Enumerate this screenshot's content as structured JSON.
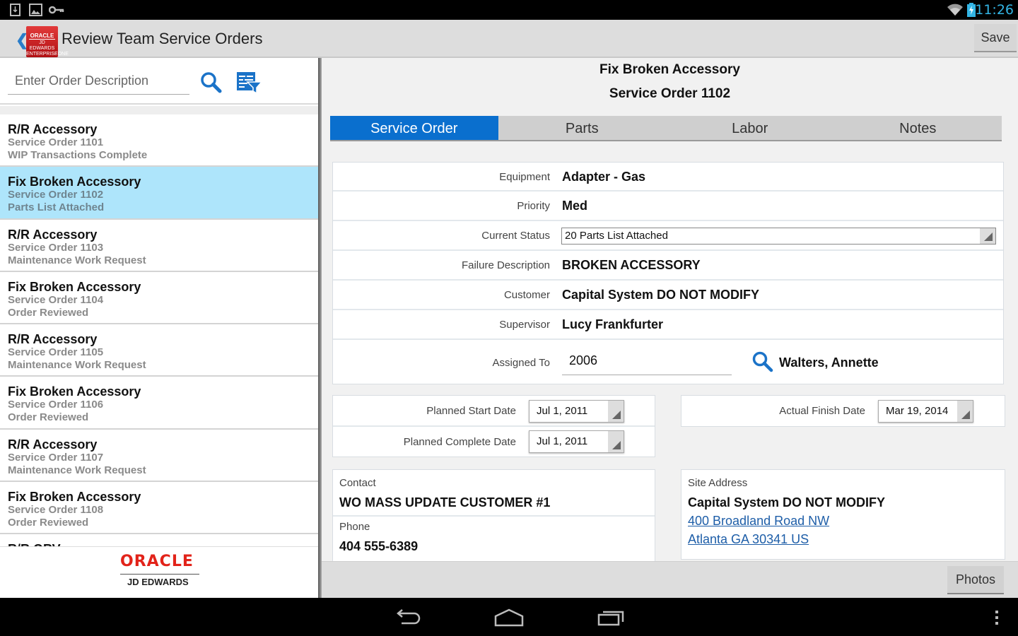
{
  "status_bar": {
    "time": "11:26",
    "left_icons": [
      "download-notification-icon",
      "image-notification-icon",
      "key-notification-icon"
    ],
    "right_icons": [
      "wifi-icon",
      "battery-charging-icon"
    ],
    "accent_color": "#33b5e5"
  },
  "action_bar": {
    "logo": {
      "line1": "ORACLE",
      "line2": "JD EDWARDS",
      "line3": "ENTERPRISEONE"
    },
    "title": "Review Team Service Orders",
    "save_label": "Save"
  },
  "left_pane": {
    "search_placeholder": "Enter Order Description",
    "orders": [
      {
        "title": "R/R Accessory",
        "order": "Service Order 1101",
        "status": "WIP Transactions Complete",
        "selected": false
      },
      {
        "title": "Fix Broken Accessory",
        "order": "Service Order 1102",
        "status": "Parts List Attached",
        "selected": true
      },
      {
        "title": "R/R Accessory",
        "order": "Service Order 1103",
        "status": "Maintenance Work Request",
        "selected": false
      },
      {
        "title": "Fix Broken Accessory",
        "order": "Service Order 1104",
        "status": "Order Reviewed",
        "selected": false
      },
      {
        "title": "R/R Accessory",
        "order": "Service Order 1105",
        "status": "Maintenance Work Request",
        "selected": false
      },
      {
        "title": "Fix Broken Accessory",
        "order": "Service Order 1106",
        "status": "Order Reviewed",
        "selected": false
      },
      {
        "title": "R/R Accessory",
        "order": "Service Order 1107",
        "status": "Maintenance Work Request",
        "selected": false
      },
      {
        "title": "Fix Broken Accessory",
        "order": "Service Order 1108",
        "status": "Order Reviewed",
        "selected": false
      },
      {
        "title": "R/R ORV",
        "order": "",
        "status": "",
        "selected": false
      }
    ],
    "footer": {
      "brand": "ORACLE",
      "product": "JD EDWARDS"
    }
  },
  "detail": {
    "title": "Fix Broken Accessory",
    "subtitle": "Service Order 1102",
    "tabs": [
      {
        "label": "Service Order",
        "active": true
      },
      {
        "label": "Parts",
        "active": false
      },
      {
        "label": "Labor",
        "active": false
      },
      {
        "label": "Notes",
        "active": false
      }
    ],
    "fields": {
      "equipment": {
        "label": "Equipment",
        "value": "Adapter - Gas"
      },
      "priority": {
        "label": "Priority",
        "value": "Med"
      },
      "current_status": {
        "label": "Current Status",
        "value": "20 Parts List Attached"
      },
      "failure_description": {
        "label": "Failure Description",
        "value": "BROKEN ACCESSORY"
      },
      "customer": {
        "label": "Customer",
        "value": "Capital System DO NOT MODIFY"
      },
      "supervisor": {
        "label": "Supervisor",
        "value": "Lucy Frankfurter"
      },
      "assigned_to": {
        "label": "Assigned To",
        "value": "2006",
        "name": "Walters, Annette"
      }
    },
    "dates": {
      "planned_start": {
        "label": "Planned Start Date",
        "value": "Jul 1, 2011"
      },
      "planned_complete": {
        "label": "Planned Complete Date",
        "value": "Jul 1, 2011"
      },
      "actual_finish": {
        "label": "Actual Finish Date",
        "value": "Mar 19, 2014"
      }
    },
    "contact": {
      "label": "Contact",
      "value": "WO MASS UPDATE CUSTOMER #1"
    },
    "phone": {
      "label": "Phone",
      "value": "404 555-6389"
    },
    "site_address": {
      "label": "Site Address",
      "name": "Capital System DO NOT MODIFY",
      "line1": "400 Broadland Road NW",
      "line2": "Atlanta GA 30341 US"
    },
    "photos_label": "Photos",
    "accent_color": "#0a6fce"
  },
  "nav_bar": {
    "buttons": [
      "back-icon",
      "home-icon",
      "recent-apps-icon",
      "overflow-menu-icon"
    ]
  }
}
